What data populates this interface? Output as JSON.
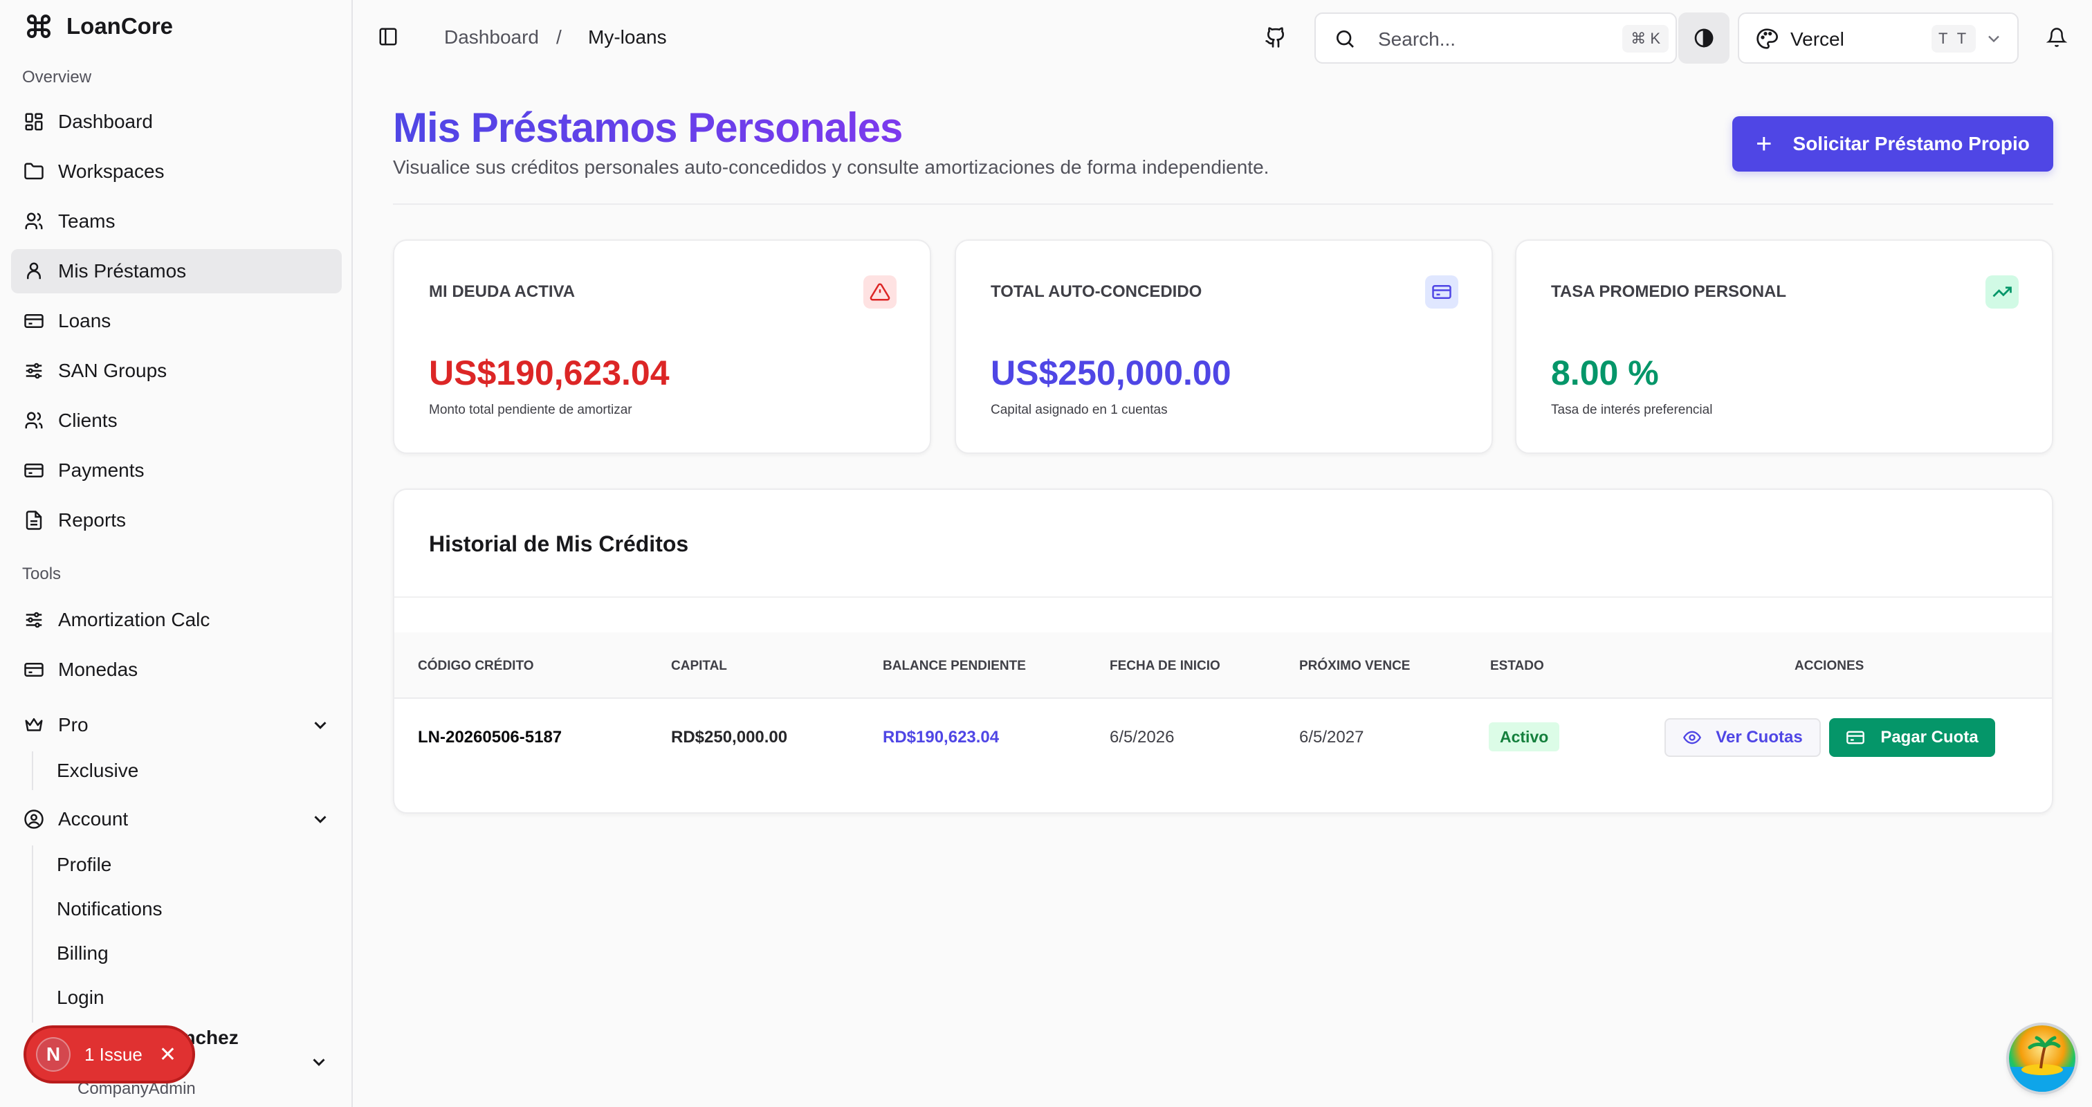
{
  "app": {
    "name": "LoanCore"
  },
  "sidebar": {
    "group_overview": "Overview",
    "items": [
      {
        "label": "Dashboard",
        "icon": "dashboard-icon"
      },
      {
        "label": "Workspaces",
        "icon": "folder-icon"
      },
      {
        "label": "Teams",
        "icon": "users-icon"
      },
      {
        "label": "Mis Préstamos",
        "icon": "user-icon",
        "active": true
      },
      {
        "label": "Loans",
        "icon": "credit-card-icon"
      },
      {
        "label": "SAN Groups",
        "icon": "sliders-icon"
      },
      {
        "label": "Clients",
        "icon": "users-icon"
      },
      {
        "label": "Payments",
        "icon": "credit-card-icon"
      },
      {
        "label": "Reports",
        "icon": "file-icon"
      }
    ],
    "group_tools": "Tools",
    "tools": [
      {
        "label": "Amortization Calc",
        "icon": "sliders-icon"
      },
      {
        "label": "Monedas",
        "icon": "credit-card-icon"
      },
      {
        "label": "Pro",
        "icon": "crown-icon"
      },
      {
        "label": "Account",
        "icon": "user-circle-icon"
      }
    ],
    "pro_children": [
      "Exclusive"
    ],
    "account_children": [
      "Profile",
      "Notifications",
      "Billing",
      "Login"
    ],
    "user": {
      "name": "al Sanchez",
      "role": "CompanyAdmin"
    }
  },
  "issue": {
    "initial": "N",
    "label": "1 Issue"
  },
  "header": {
    "breadcrumb": [
      "Dashboard",
      "My-loans"
    ],
    "breadcrumb_sep": "/",
    "search_placeholder": "Search...",
    "search_kbd": "⌘ K",
    "workspace_name": "Vercel",
    "workspace_kbd": "T T"
  },
  "main": {
    "title": "Mis Préstamos Personales",
    "subtitle": "Visualice sus créditos personales auto-concedidos y consulte amortizaciones de forma independiente.",
    "primary_button": "Solicitar Préstamo Propio",
    "cards": [
      {
        "title": "MI DEUDA ACTIVA",
        "value": "US$190,623.04",
        "note": "Monto total pendiente de amortizar",
        "color": "#dc2626",
        "icon": "alert-triangle-icon"
      },
      {
        "title": "TOTAL AUTO-CONCEDIDO",
        "value": "US$250,000.00",
        "note": "Capital asignado en 1 cuentas",
        "color": "#4f46e5",
        "icon": "credit-card-icon"
      },
      {
        "title": "TASA PROMEDIO PERSONAL",
        "value": "8.00 %",
        "note": "Tasa de interés preferencial",
        "color": "#059669",
        "icon": "trending-up-icon"
      }
    ],
    "table": {
      "title": "Historial de Mis Créditos",
      "columns": [
        "CÓDIGO CRÉDITO",
        "CAPITAL",
        "BALANCE PENDIENTE",
        "FECHA DE INICIO",
        "PRÓXIMO VENCE",
        "ESTADO",
        "ACCIONES"
      ],
      "rows": [
        {
          "code": "LN-20260506-5187",
          "capital": "RD$250,000.00",
          "balance": "RD$190,623.04",
          "start": "6/5/2026",
          "next_due": "6/5/2027",
          "status": "Activo",
          "action_view": "Ver Cuotas",
          "action_pay": "Pagar Cuota"
        }
      ]
    }
  }
}
